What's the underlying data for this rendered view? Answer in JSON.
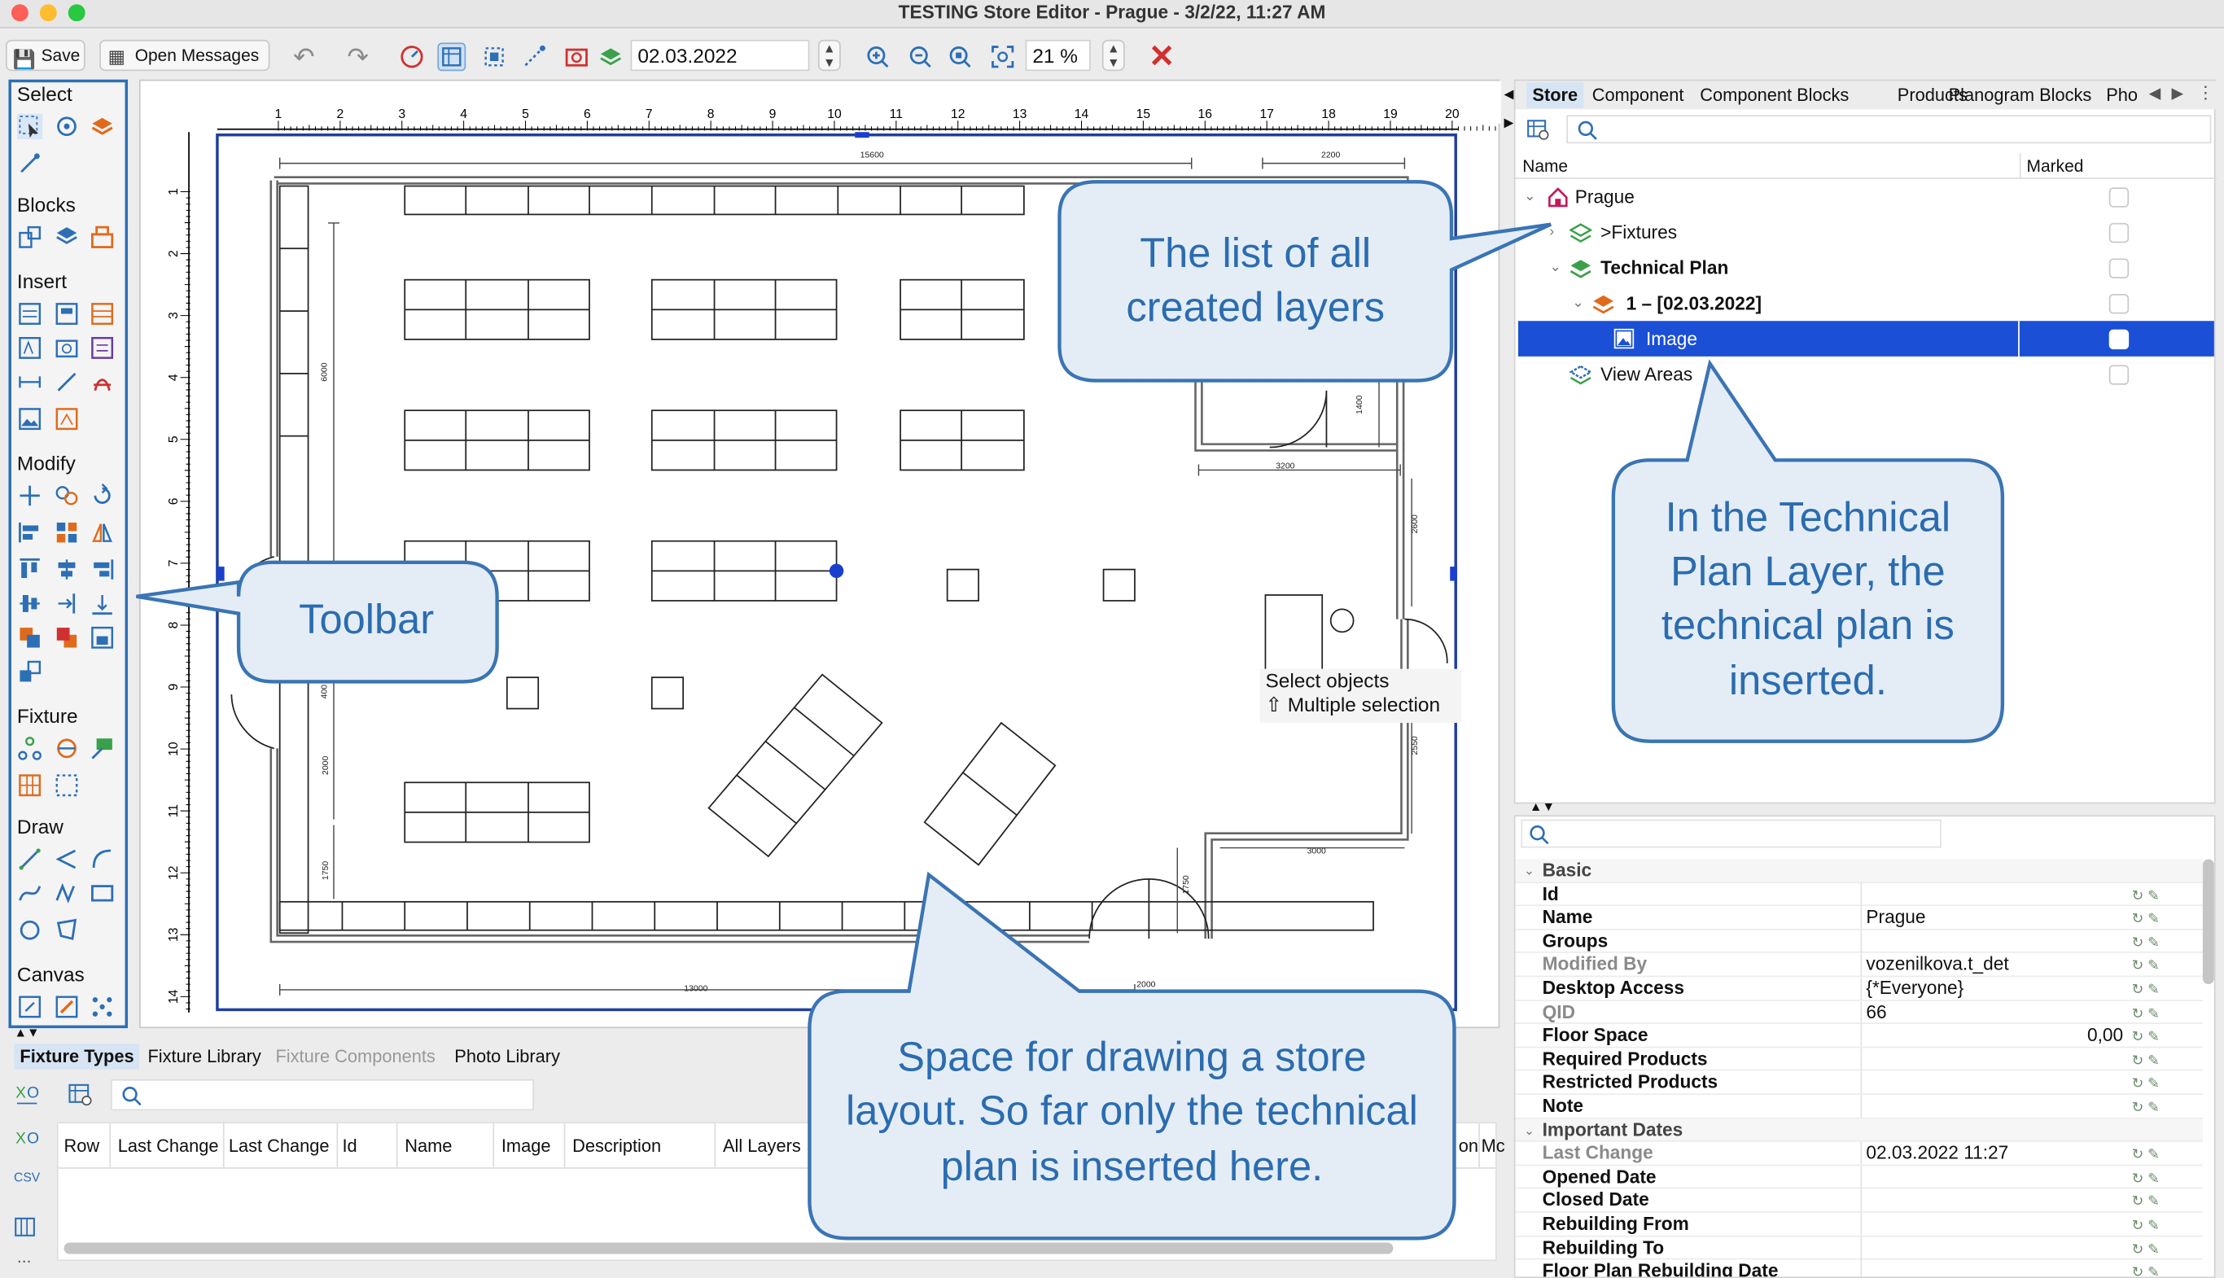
{
  "window": {
    "title": "TESTING Store Editor - Prague - 3/2/22, 11:27 AM"
  },
  "toolbar": {
    "save_label": "Save",
    "messages_label": "Open Messages",
    "date_value": "02.03.2022",
    "zoom_value": "21 %"
  },
  "left_toolbar": {
    "sections": {
      "select": "Select",
      "blocks": "Blocks",
      "insert": "Insert",
      "modify": "Modify",
      "fixture": "Fixture",
      "draw": "Draw",
      "canvas": "Canvas"
    }
  },
  "canvas": {
    "ruler_top": [
      "1",
      "2",
      "3",
      "4",
      "5",
      "6",
      "7",
      "8",
      "9",
      "10",
      "11",
      "12",
      "13",
      "14",
      "15",
      "16",
      "17",
      "18",
      "19",
      "20"
    ],
    "ruler_left": [
      "1",
      "2",
      "3",
      "4",
      "5",
      "6",
      "7",
      "8",
      "9",
      "10",
      "11",
      "12",
      "13",
      "14"
    ],
    "dims": {
      "d15600": "15600",
      "d2200": "2200",
      "d6000": "6000",
      "d1400": "1400",
      "d3200": "3200",
      "d2600": "2600",
      "d2550": "2550",
      "d3000": "3000",
      "d1750a": "1750",
      "d1750b": "1750",
      "d2000a": "2000",
      "d2000b": "2000",
      "d13000": "13000",
      "d400": "400"
    },
    "tooltip": {
      "line1": "Select objects",
      "line2": "Multiple selection"
    }
  },
  "right_panel": {
    "tabs": [
      "Store",
      "Component",
      "Component Blocks",
      "Products",
      "Planogram Blocks",
      "Pho"
    ],
    "columns": {
      "name": "Name",
      "marked": "Marked"
    },
    "tree": [
      {
        "label": "Prague"
      },
      {
        "label": ">Fixtures"
      },
      {
        "label": "Technical Plan"
      },
      {
        "label": "1 – [02.03.2022]"
      },
      {
        "label": "Image"
      },
      {
        "label": "View Areas"
      }
    ]
  },
  "properties": {
    "groups": {
      "basic": "Basic",
      "important_dates": "Important Dates"
    },
    "rows": [
      {
        "key": "Id",
        "value": ""
      },
      {
        "key": "Name",
        "value": "Prague"
      },
      {
        "key": "Groups",
        "value": ""
      },
      {
        "key": "Modified By",
        "value": "vozenilkova.t_det"
      },
      {
        "key": "Desktop Access",
        "value": "{*Everyone}"
      },
      {
        "key": "QID",
        "value": "66"
      },
      {
        "key": "Floor Space",
        "value": "0,00"
      },
      {
        "key": "Required Products",
        "value": ""
      },
      {
        "key": "Restricted Products",
        "value": ""
      },
      {
        "key": "Note",
        "value": ""
      },
      {
        "key": "Last Change",
        "value": "02.03.2022 11:27"
      },
      {
        "key": "Opened Date",
        "value": ""
      },
      {
        "key": "Closed Date",
        "value": ""
      },
      {
        "key": "Rebuilding From",
        "value": ""
      },
      {
        "key": "Rebuilding To",
        "value": ""
      },
      {
        "key": "Floor Plan Rebuilding Date",
        "value": ""
      }
    ]
  },
  "bottom_panel": {
    "tabs": [
      "Fixture Types",
      "Fixture Library",
      "Fixture Components",
      "Photo Library"
    ],
    "columns": [
      "Row",
      "Last Change",
      "Last Change",
      "Id",
      "Name",
      "Image",
      "Description",
      "All Layers"
    ],
    "trailing_columns": [
      "on",
      "Mc"
    ],
    "side_labels": {
      "csv": "CSV",
      "more": "..."
    }
  },
  "callouts": {
    "layers": [
      "The list of all",
      "created layers"
    ],
    "toolbar": [
      "Toolbar"
    ],
    "technical": [
      "In the Technical",
      "Plan Layer, the",
      "technical plan is",
      "inserted."
    ],
    "drawing": [
      "Space for drawing a store",
      "layout. So far only the technical",
      "plan is inserted here."
    ]
  },
  "colors": {
    "accent": "#2d6fb4",
    "selection": "#1a4fd6",
    "callout_fill": "#e4edf6",
    "callout_text": "#2b6cb0"
  }
}
